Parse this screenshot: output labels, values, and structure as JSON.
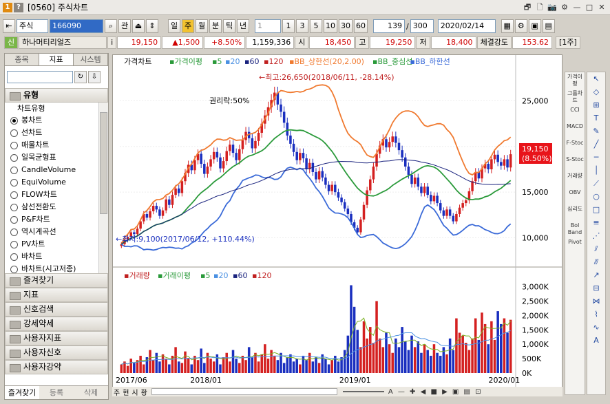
{
  "window": {
    "num": "1",
    "help": "?",
    "code": "[0560]",
    "title": "주식차트",
    "controls": [
      "🗗",
      "🗋",
      "📷",
      "⚙",
      "—",
      "□",
      "✕"
    ]
  },
  "toolbar": {
    "market": "주식",
    "code": "166090",
    "search": "관",
    "periods": [
      "일",
      "주",
      "월",
      "분",
      "틱",
      "년"
    ],
    "period_selected": "주",
    "count_sel": "1",
    "nums": [
      "1",
      "3",
      "5",
      "10",
      "30",
      "60"
    ],
    "count": "139",
    "slash": "/",
    "total": "300",
    "date": "2020/02/14"
  },
  "price": {
    "badge": "신",
    "name": "하나머티리얼즈",
    "info": "i",
    "close": "19,150",
    "change": "▲1,500",
    "pct": "+8.50%",
    "volume": "1,159,336",
    "open_lab": "시",
    "open": "18,450",
    "high_lab": "고",
    "high": "19,250",
    "low_lab": "저",
    "low": "18,400",
    "strength_lab": "체결강도",
    "strength": "153.62",
    "unit": "[1주]"
  },
  "left": {
    "tabs": [
      "종목",
      "지표",
      "시스템"
    ],
    "active_tab": "지표",
    "section": "유형",
    "tree_header": "차트유형",
    "items": [
      "봉차트",
      "선차트",
      "매물차트",
      "일목균형표",
      "CandleVolume",
      "EquiVolume",
      "FLOW차트",
      "삼선전환도",
      "P&F차트",
      "역시계곡선",
      "PV차트",
      "바차트",
      "바차트(시고저종)"
    ],
    "selected": "봉차트",
    "folders": [
      "즐겨찾기",
      "지표",
      "신호검색",
      "강세약세",
      "사용자지표",
      "사용자신호",
      "사용자강약"
    ],
    "bottom_tabs": [
      "즐겨찾기",
      "등록",
      "삭제"
    ]
  },
  "chart": {
    "price_legend": [
      "가격차트",
      "가격이평",
      "5",
      "20",
      "60",
      "120",
      "BB_상한선(20,2.00)",
      "BB_중심선",
      "BB_하한선"
    ],
    "vol_legend": [
      "거래량",
      "거래이평",
      "5",
      "20",
      "60",
      "120"
    ],
    "high_note": "←최고:26,650(2018/06/11, -28.14%)",
    "low_note": "←최저:9,100(2017/06/12, +110.44%)",
    "rights_note": "권리락:50%",
    "price_ticks": [
      "25,000",
      "20,000",
      "15,000",
      "10,000"
    ],
    "vol_ticks": [
      "3,000K",
      "2,500K",
      "2,000K",
      "1,500K",
      "1,000K",
      "500K",
      "0K"
    ],
    "x_ticks": [
      "2017/06",
      "2018/01",
      "2019/01",
      "2020/01"
    ],
    "last_price": "19,150",
    "last_pct": "(8.50%)",
    "bottom_tabs": [
      "주",
      "현",
      "시",
      "황"
    ]
  },
  "colors": {
    "up": "#d42020",
    "down": "#1a2fbf",
    "bb_upper": "#f07a30",
    "bb_mid": "#2a9a3a",
    "bb_lower": "#3a6ad8",
    "ma": "#1a237e"
  },
  "right_tools": [
    "가격이평",
    "그룹차트",
    "CCI",
    "MACD",
    "F-Stoc",
    "S-Stoc",
    "거래량",
    "OBV",
    "심리도",
    "Bol Band",
    "Pivot"
  ],
  "chart_data": {
    "type": "candlestick",
    "ylim": [
      8000,
      27000
    ],
    "high": 26650,
    "low": 9100,
    "closes": [
      9300,
      9800,
      10100,
      10600,
      10400,
      11000,
      11800,
      12600,
      12200,
      12900,
      13500,
      13100,
      12400,
      13000,
      14200,
      13600,
      14700,
      15400,
      14900,
      16200,
      17100,
      18000,
      17400,
      18500,
      19200,
      18100,
      17000,
      17800,
      18600,
      19400,
      18800,
      17600,
      18400,
      19500,
      20200,
      19300,
      18500,
      19700,
      20700,
      21600,
      20900,
      19800,
      20600,
      21500,
      22500,
      23400,
      24300,
      25100,
      25900,
      24600,
      23800,
      22600,
      21200,
      20300,
      19400,
      18500,
      19300,
      18700,
      17500,
      18200,
      17200,
      16400,
      17300,
      16600,
      15800,
      15100,
      15800,
      15000,
      14400,
      13900,
      13200,
      12600,
      11700,
      11100,
      10600,
      12000,
      13600,
      15200,
      16400,
      17800,
      19200,
      20100,
      20800,
      19900,
      20500,
      21100,
      20400,
      19600,
      18800,
      17800,
      16900,
      15900,
      16600,
      15600,
      14900,
      15600,
      14700,
      14000,
      14600,
      13800,
      13000,
      12400,
      13100,
      12400,
      11800,
      12600,
      13300,
      13800,
      14100,
      15100,
      16200,
      17200,
      16500,
      17600,
      18100,
      17500,
      18600,
      19100,
      18300,
      17900,
      18600,
      17700,
      19150
    ],
    "volume_k": [
      300,
      400,
      250,
      500,
      350,
      450,
      600,
      300,
      550,
      800,
      450,
      700,
      400,
      650,
      500,
      300,
      600,
      900,
      400,
      350,
      750,
      500,
      300,
      600,
      450,
      850,
      350,
      700,
      500,
      400,
      650,
      300,
      550,
      700,
      400,
      800,
      500,
      350,
      600,
      450,
      900,
      550,
      700,
      400,
      650,
      1000,
      500,
      800,
      600,
      450,
      700,
      350,
      550,
      650,
      400,
      500,
      300,
      600,
      450,
      700,
      400,
      550,
      350,
      650,
      500,
      300,
      450,
      600,
      400,
      550,
      800,
      1300,
      3050,
      2300,
      1500,
      900,
      1800,
      1200,
      1600,
      1050,
      2500,
      1200,
      900,
      1400,
      1000,
      700,
      1200,
      900,
      1600,
      1100,
      800,
      1300,
      900,
      1100,
      700,
      1000,
      800,
      600,
      1000,
      700,
      600,
      900,
      650,
      1200,
      800,
      1900,
      1400,
      1300,
      1050,
      800,
      1200,
      1900,
      1150,
      2100,
      1700,
      1000,
      1800,
      1150,
      2150,
      1700,
      1900,
      1400,
      1850
    ]
  }
}
